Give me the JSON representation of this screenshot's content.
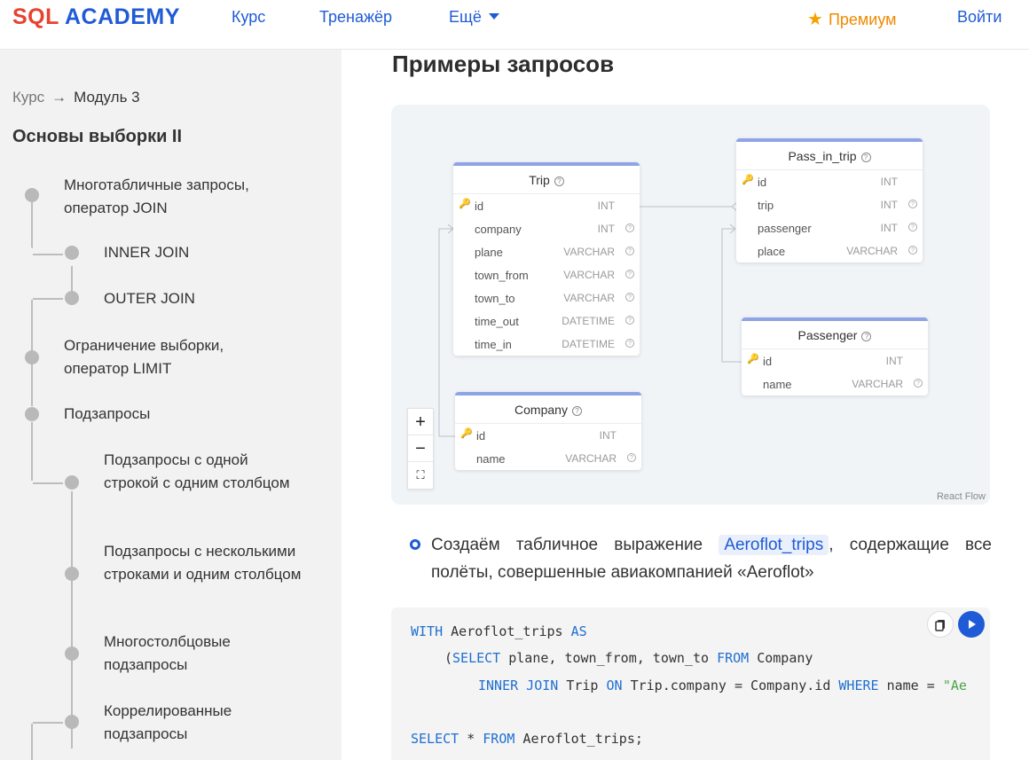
{
  "header": {
    "logo_sql": "SQL",
    "logo_academy": "ACADEMY",
    "nav": {
      "course": "Курс",
      "trainer": "Тренажёр",
      "more": "Ещё"
    },
    "premium": "Премиум",
    "login": "Войти"
  },
  "sidebar": {
    "breadcrumb": {
      "course": "Курс",
      "arrow": "→",
      "module": "Модуль 3"
    },
    "module_title": "Основы выборки II",
    "items": [
      {
        "label": "Многотабличные запросы, оператор JOIN"
      },
      {
        "label": "INNER JOIN"
      },
      {
        "label": "OUTER JOIN"
      },
      {
        "label": "Ограничение выборки, оператор LIMIT"
      },
      {
        "label": "Подзапросы"
      },
      {
        "label": "Подзапросы с одной строкой с одним столбцом"
      },
      {
        "label": "Подзапросы с несколькими строками и одним столбцом"
      },
      {
        "label": "Многостолбцовые подзапросы"
      },
      {
        "label": "Коррелированные подзапросы"
      }
    ]
  },
  "main": {
    "section_title": "Примеры запросов",
    "diagram": {
      "tables": [
        {
          "name": "Trip",
          "fields": [
            {
              "name": "id",
              "type": "INT",
              "key": true
            },
            {
              "name": "company",
              "type": "INT"
            },
            {
              "name": "plane",
              "type": "VARCHAR"
            },
            {
              "name": "town_from",
              "type": "VARCHAR"
            },
            {
              "name": "town_to",
              "type": "VARCHAR"
            },
            {
              "name": "time_out",
              "type": "DATETIME"
            },
            {
              "name": "time_in",
              "type": "DATETIME"
            }
          ]
        },
        {
          "name": "Pass_in_trip",
          "fields": [
            {
              "name": "id",
              "type": "INT",
              "key": true
            },
            {
              "name": "trip",
              "type": "INT"
            },
            {
              "name": "passenger",
              "type": "INT"
            },
            {
              "name": "place",
              "type": "VARCHAR"
            }
          ]
        },
        {
          "name": "Passenger",
          "fields": [
            {
              "name": "id",
              "type": "INT",
              "key": true
            },
            {
              "name": "name",
              "type": "VARCHAR"
            }
          ]
        },
        {
          "name": "Company",
          "fields": [
            {
              "name": "id",
              "type": "INT",
              "key": true
            },
            {
              "name": "name",
              "type": "VARCHAR"
            }
          ]
        }
      ],
      "controls": {
        "zoom_in": "+",
        "zoom_out": "−",
        "fit": "⛶"
      },
      "attribution": "React Flow"
    },
    "bullet": {
      "before": "Создаём табличное выражение",
      "code": "Aeroflot_trips",
      "after": ", содержащие все полёты, совершенные авиакомпанией «Aeroflot»"
    },
    "code_lines": {
      "l1_kw1": "WITH",
      "l1_name": " Aeroflot_trips ",
      "l1_kw2": "AS",
      "l2_paren": "(",
      "l2_kw1": "SELECT",
      "l2_rest": " plane, town_from, town_to ",
      "l2_kw2": "FROM",
      "l2_tbl": " Company",
      "l3_kw1": "INNER JOIN",
      "l3_a": " Trip ",
      "l3_kw2": "ON",
      "l3_b": " Trip.company = Company.id ",
      "l3_kw3": "WHERE",
      "l3_c": " name = ",
      "l3_str": "\"Ae",
      "l5_kw1": "SELECT",
      "l5_a": " * ",
      "l5_kw2": "FROM",
      "l5_b": " Aeroflot_trips;"
    }
  },
  "colors": {
    "accent": "#1f5bd6",
    "premium": "#f08a00",
    "logo_red": "#e8412f"
  }
}
